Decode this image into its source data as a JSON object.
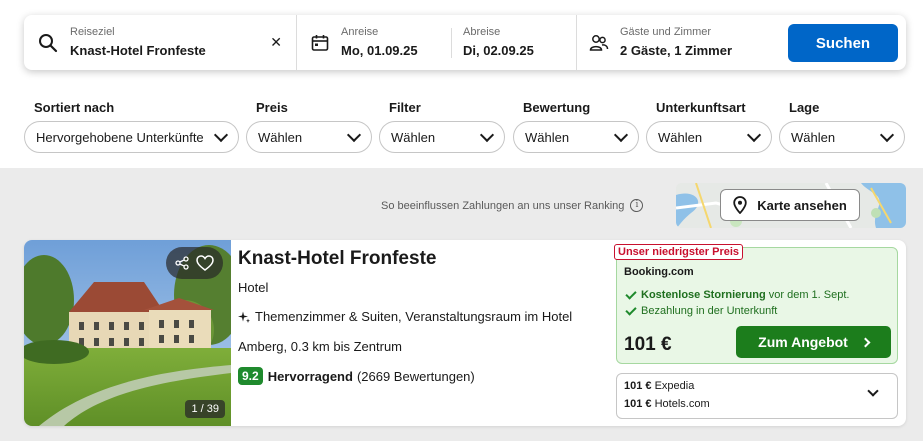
{
  "search": {
    "destination_label": "Reiseziel",
    "destination_value": "Knast-Hotel Fronfeste",
    "clear_symbol": "✕",
    "checkin_label": "Anreise",
    "checkin_value": "Mo, 01.09.25",
    "checkout_label": "Abreise",
    "checkout_value": "Di, 02.09.25",
    "guests_label": "Gäste und Zimmer",
    "guests_value": "2 Gäste, 1 Zimmer",
    "search_button": "Suchen"
  },
  "filters": [
    {
      "label": "Sortiert nach",
      "value": "Hervorgehobene Unterkünfte"
    },
    {
      "label": "Preis",
      "value": "Wählen"
    },
    {
      "label": "Filter",
      "value": "Wählen"
    },
    {
      "label": "Bewertung",
      "value": "Wählen"
    },
    {
      "label": "Unterkunftsart",
      "value": "Wählen"
    },
    {
      "label": "Lage",
      "value": "Wählen"
    }
  ],
  "ranking_note": "So beeinflussen Zahlungen an uns unser Ranking",
  "map_button": "Karte ansehen",
  "hotel": {
    "name": "Knast-Hotel Fronfeste",
    "type": "Hotel",
    "amenities": "Themenzimmer & Suiten, Veranstaltungsraum im Hotel",
    "location": "Amberg, 0.3 km bis Zentrum",
    "score": "9.2",
    "rating_word": "Hervorragend",
    "reviews": "(2669 Bewertungen)",
    "photo_count": "1 / 39"
  },
  "deal": {
    "badge": "Unser niedrigster Preis",
    "provider": "Booking.com",
    "feature1_bold": "Kostenlose Stornierung",
    "feature1_rest": " vor dem 1. Sept.",
    "feature2": "Bezahlung in der Unterkunft",
    "price": "101 €",
    "cta": "Zum Angebot"
  },
  "other_offers": [
    {
      "price": "101 €",
      "provider": "Expedia"
    },
    {
      "price": "101 €",
      "provider": "Hotels.com"
    }
  ],
  "colors": {
    "primary_button": "#0066c8",
    "deal_button": "#1c7d1c",
    "score_badge": "#1f8a2d",
    "badge_red": "#c8102e",
    "deal_bg": "#e9f7e6"
  }
}
